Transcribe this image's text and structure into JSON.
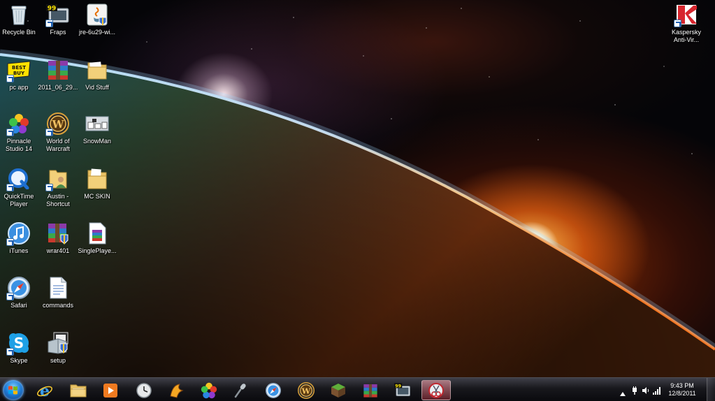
{
  "desktop": {
    "icons": [
      {
        "label": "Recycle Bin",
        "icon": "recycle-bin-icon"
      },
      {
        "label": "Fraps",
        "icon": "fraps-icon",
        "badge": "99"
      },
      {
        "label": "jre-6u29-wi...",
        "icon": "java-installer-icon"
      },
      {
        "label": "pc app",
        "icon": "best-buy-icon",
        "badge": "BEST BUY"
      },
      {
        "label": "2011_06_29...",
        "icon": "winrar-archive-icon"
      },
      {
        "label": "Vid Stuff",
        "icon": "folder-icon"
      },
      {
        "label": "Pinnacle\nStudio 14",
        "icon": "pinnacle-studio-icon"
      },
      {
        "label": "World of\nWarcraft",
        "icon": "world-of-warcraft-icon"
      },
      {
        "label": "SnowMan",
        "icon": "snowman-image-icon"
      },
      {
        "label": "QuickTime\nPlayer",
        "icon": "quicktime-icon"
      },
      {
        "label": "Austin -\nShortcut",
        "icon": "user-folder-shortcut-icon"
      },
      {
        "label": "MC SKIN",
        "icon": "folder-icon"
      },
      {
        "label": "iTunes",
        "icon": "itunes-icon"
      },
      {
        "label": "wrar401",
        "icon": "winrar-installer-icon"
      },
      {
        "label": "SinglePlaye...",
        "icon": "archive-file-icon"
      },
      {
        "label": "Safari",
        "icon": "safari-icon"
      },
      {
        "label": "commands",
        "icon": "text-document-icon"
      },
      {
        "label": "Skype",
        "icon": "skype-icon"
      },
      {
        "label": "setup",
        "icon": "setup-installer-icon"
      },
      {
        "label": "Kaspersky\nAnti-Vir...",
        "icon": "kaspersky-icon"
      }
    ]
  },
  "taskbar": {
    "items": [
      {
        "name": "internet-explorer",
        "icon": "internet-explorer-icon"
      },
      {
        "name": "windows-explorer",
        "icon": "folder-icon"
      },
      {
        "name": "media-player",
        "icon": "media-player-icon"
      },
      {
        "name": "clock-app",
        "icon": "clock-icon"
      },
      {
        "name": "winamp",
        "icon": "winamp-icon"
      },
      {
        "name": "pinnacle-studio",
        "icon": "pinnacle-studio-icon"
      },
      {
        "name": "microphone",
        "icon": "microphone-icon"
      },
      {
        "name": "safari",
        "icon": "safari-icon"
      },
      {
        "name": "world-of-warcraft",
        "icon": "world-of-warcraft-icon"
      },
      {
        "name": "minecraft",
        "icon": "minecraft-icon"
      },
      {
        "name": "winrar",
        "icon": "winrar-icon"
      },
      {
        "name": "fraps",
        "icon": "fraps-icon",
        "badge": "99"
      },
      {
        "name": "snipping-tool",
        "icon": "snipping-tool-icon",
        "active": true
      }
    ],
    "tray": {
      "time": "9:43 PM",
      "date": "12/8/2011"
    }
  }
}
